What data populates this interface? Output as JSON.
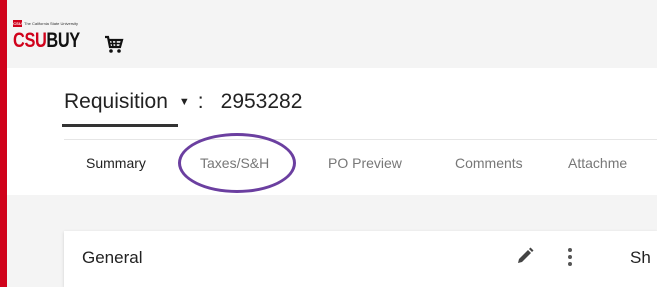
{
  "logo": {
    "badge": "CSU",
    "university_line": "The California State University",
    "csu": "CSU",
    "buy": "BUY",
    "cart_icon": "shopping-cart-icon"
  },
  "requisition": {
    "title": "Requisition",
    "caret_icon": "caret-down-icon",
    "separator": ":",
    "number": "2953282"
  },
  "tabs": [
    {
      "label": "Summary",
      "active": true
    },
    {
      "label": "Taxes/S&H",
      "active": false,
      "highlighted": true
    },
    {
      "label": "PO Preview",
      "active": false
    },
    {
      "label": "Comments",
      "active": false
    },
    {
      "label": "Attachme",
      "active": false
    }
  ],
  "card": {
    "title": "General",
    "edit_icon": "pencil-icon",
    "more_icon": "more-vertical-icon",
    "side_title": "Sh"
  },
  "colors": {
    "brand_red": "#d0021b",
    "highlight_purple": "#6b3fa0"
  }
}
